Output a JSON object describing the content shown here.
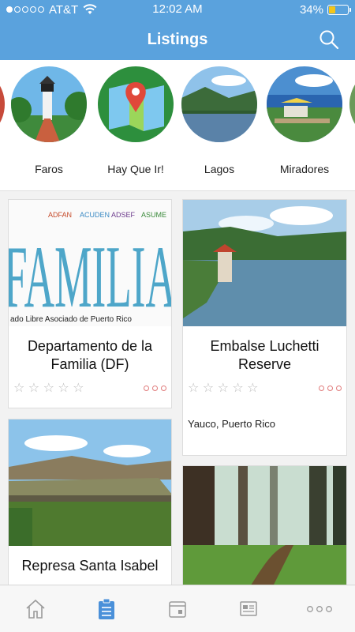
{
  "status": {
    "carrier": "AT&T",
    "time": "12:02 AM",
    "battery": "34%",
    "battery_level": 0.34
  },
  "header": {
    "title": "Listings"
  },
  "categories": [
    {
      "label": "Faros"
    },
    {
      "label": "Hay Que Ir!"
    },
    {
      "label": "Lagos"
    },
    {
      "label": "Miradores"
    }
  ],
  "cards": [
    {
      "title": "Departamento de la Familia (DF)",
      "stars": "☆ ☆ ☆ ☆ ☆",
      "image_caption": "ado Libre Asociado de Puerto Rico",
      "image_headline": "FAMILIA",
      "image_tags": [
        "ADFAN",
        "ACUDEN",
        "ADSEF",
        "ASUME"
      ]
    },
    {
      "title": "Embalse Luchetti Reserve",
      "stars": "☆ ☆ ☆ ☆ ☆",
      "location": "Yauco, Puerto Rico"
    },
    {
      "title": "Represa Santa Isabel"
    },
    {
      "title": ""
    }
  ],
  "colors": {
    "primary": "#5aa2dd",
    "active_tab": "#4a90d9",
    "inactive_tab": "#9a9a9a"
  },
  "tabbar": [
    {
      "icon": "home-icon",
      "active": false
    },
    {
      "icon": "listings-icon",
      "active": true
    },
    {
      "icon": "calendar-icon",
      "active": false
    },
    {
      "icon": "news-icon",
      "active": false
    },
    {
      "icon": "more-icon",
      "active": false
    }
  ]
}
